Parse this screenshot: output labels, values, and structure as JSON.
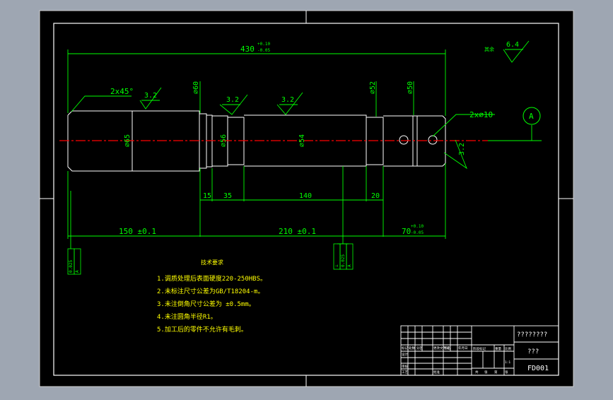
{
  "colors": {
    "background": "#9ea6b2",
    "sheet": "#000000",
    "frame": "#ffffff",
    "geometry": "#ffffff",
    "dimension": "#00ff00",
    "centerline": "#ff0000",
    "notes": "#ffff00",
    "border_gray": "#cfcfcf"
  },
  "dimensions": {
    "overall": "430",
    "overall_tol_upper": "+0.10",
    "overall_tol_lower": "-0.05",
    "chamfer": "2x45°",
    "dia_60": "⌀60",
    "dia_65": "⌀65",
    "dia_56": "⌀56",
    "dia_54": "⌀54",
    "dia_52": "⌀52",
    "dia_50": "⌀50",
    "hole": "2x⌀10",
    "seg_15": "15",
    "seg_35": "35",
    "seg_140": "140",
    "seg_20": "20",
    "len_150": "150 ±0.1",
    "len_210": "210 ±0.1",
    "len_70": "70",
    "len_70_tol_upper": "+0.10",
    "len_70_tol_lower": "-0.05"
  },
  "roughness": {
    "general": "6.4",
    "general_label": "其余",
    "r1": "3.2",
    "r2": "3.2",
    "r3": "3.2",
    "r4": "3.2"
  },
  "datum": {
    "label": "A"
  },
  "tolerance_frames": {
    "left": [
      "⊥",
      "0.025",
      "A"
    ],
    "middle": [
      "⊥",
      "0.025",
      "A"
    ],
    "right": [
      "∥",
      "0.025",
      "A"
    ]
  },
  "notes": {
    "title": "技术要求",
    "items": [
      "1.调质处理后表面硬度220-250HBS。",
      "2.未标注尺寸公差为GB/T18204-m。",
      "3.未注倒角尺寸公差为 ±0.5mm。",
      "4.未注圆角半径R1。",
      "5.加工后的零件不允许有毛刺。"
    ]
  },
  "title_block": {
    "drawing_name": "????????",
    "material": "???",
    "drawing_code": "FD001",
    "scale": "1:1",
    "row_labels": [
      "标记",
      "处数",
      "分区",
      "更改文件号",
      "签名",
      "年月日"
    ],
    "approval_labels": [
      "设计",
      "审核",
      "工艺",
      "批准"
    ],
    "stage_labels": [
      "阶段标记",
      "重量",
      "比例"
    ],
    "sheet_labels": [
      "共",
      "张",
      "第",
      "张"
    ]
  }
}
